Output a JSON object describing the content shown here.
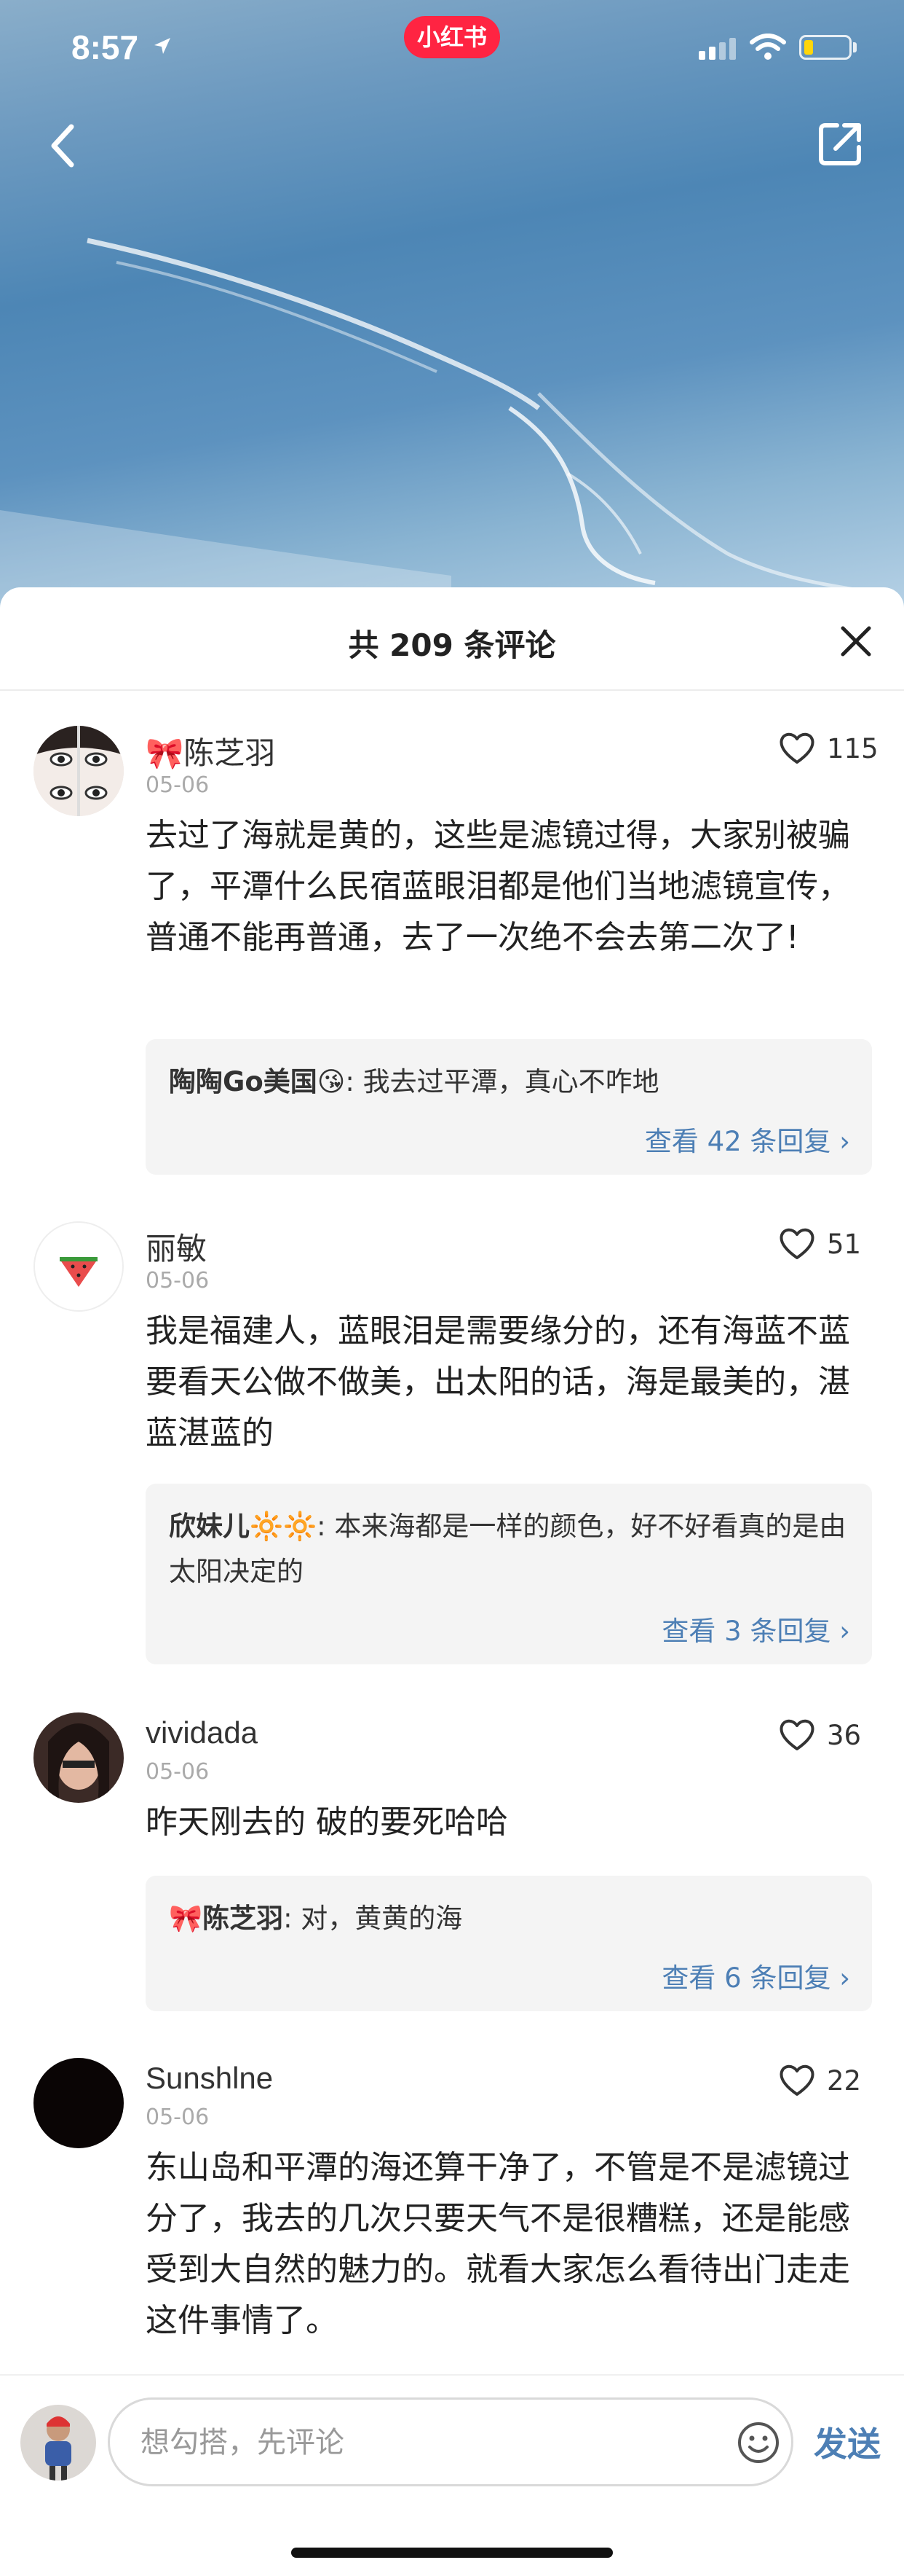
{
  "status_bar": {
    "time": "8:57",
    "app_badge": "小红书"
  },
  "sheet": {
    "title": "共 209 条评论"
  },
  "comments": [
    {
      "username": "🎀陈芝羽",
      "date": "05-06",
      "likes": "115",
      "text": "去过了海就是黄的，这些是滤镜过得，大家别被骗了，平潭什么民宿蓝眼泪都是他们当地滤镜宣传，普通不能再普通，去了一次绝不会去第二次了!",
      "reply_user": "陶陶Go美国😘",
      "reply_text": ": 我去过平潭，真心不咋地",
      "view_more": "查看 42 条回复 ›"
    },
    {
      "username": "丽敏",
      "date": "05-06",
      "likes": "51",
      "text": "我是福建人，蓝眼泪是需要缘分的，还有海蓝不蓝要看天公做不做美，出太阳的话，海是最美的，湛蓝湛蓝的",
      "reply_user": "欣妹儿🔆🔆",
      "reply_text": ": 本来海都是一样的颜色，好不好看真的是由太阳决定的",
      "view_more": "查看 3 条回复 ›"
    },
    {
      "username": "vividada",
      "date": "05-06",
      "likes": "36",
      "text": "昨天刚去的 破的要死哈哈",
      "reply_user": "🎀陈芝羽",
      "reply_text": ": 对，黄黄的海",
      "view_more": "查看 6 条回复 ›"
    },
    {
      "username": "Sunshlne",
      "date": "05-06",
      "likes": "22",
      "text": "东山岛和平潭的海还算干净了，不管是不是滤镜过分了，我去的几次只要天气不是很糟糕，还是能感受到大自然的魅力的。就看大家怎么看待出门走走这件事情了。"
    }
  ],
  "bottom_bar": {
    "input_placeholder": "想勾搭，先评论",
    "send_label": "发送"
  },
  "colors": {
    "brand": "#ff2442",
    "link": "#4d7fb5",
    "sea": "#4d86b5"
  },
  "icons": [
    "back-arrow-icon",
    "share-icon",
    "close-icon",
    "heart-icon",
    "emoji-icon",
    "signal-icon",
    "wifi-icon",
    "battery-icon",
    "location-arrow-icon"
  ]
}
